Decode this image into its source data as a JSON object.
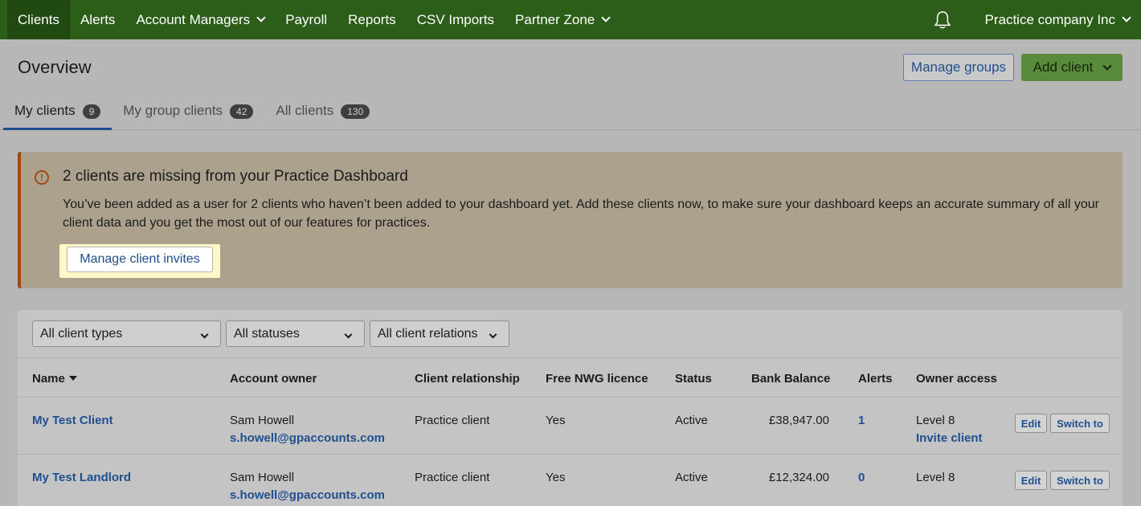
{
  "nav": {
    "items": [
      {
        "label": "Clients",
        "dropdown": false
      },
      {
        "label": "Alerts",
        "dropdown": false
      },
      {
        "label": "Account Managers",
        "dropdown": true
      },
      {
        "label": "Payroll",
        "dropdown": false
      },
      {
        "label": "Reports",
        "dropdown": false
      },
      {
        "label": "CSV Imports",
        "dropdown": false
      },
      {
        "label": "Partner Zone",
        "dropdown": true
      }
    ],
    "active": "Clients",
    "company": "Practice company Inc"
  },
  "header": {
    "title": "Overview",
    "manage_groups": "Manage groups",
    "add_client": "Add client"
  },
  "tabs": [
    {
      "label": "My clients",
      "count": "9"
    },
    {
      "label": "My group clients",
      "count": "42"
    },
    {
      "label": "All clients",
      "count": "130"
    }
  ],
  "banner": {
    "title": "2 clients are missing from your Practice Dashboard",
    "text": "You’ve been added as a user for 2 clients who haven’t been added to your dashboard yet. Add these clients now, to make sure your dashboard keeps an accurate summary of all your client data and you get the most out of our features for practices.",
    "button": "Manage client invites"
  },
  "filters": {
    "client_types": "All client types",
    "statuses": "All statuses",
    "relations": "All client relations"
  },
  "table": {
    "headers": {
      "name": "Name",
      "owner": "Account owner",
      "relationship": "Client relationship",
      "licence": "Free NWG licence",
      "status": "Status",
      "balance": "Bank Balance",
      "alerts": "Alerts",
      "access": "Owner access"
    },
    "rows": [
      {
        "name": "My Test Client",
        "owner": "Sam Howell",
        "owner_email": "s.howell@gpaccounts.com",
        "relationship": "Practice client",
        "licence": "Yes",
        "status": "Active",
        "balance": "£38,947.00",
        "alerts": "1",
        "access": "Level 8",
        "access_link": "Invite client",
        "edit": "Edit",
        "switch": "Switch to"
      },
      {
        "name": "My Test Landlord",
        "owner": "Sam Howell",
        "owner_email": "s.howell@gpaccounts.com",
        "relationship": "Practice client",
        "licence": "Yes",
        "status": "Active",
        "balance": "£12,324.00",
        "alerts": "0",
        "access": "Level 8",
        "access_link": "",
        "edit": "Edit",
        "switch": "Switch to"
      }
    ]
  }
}
